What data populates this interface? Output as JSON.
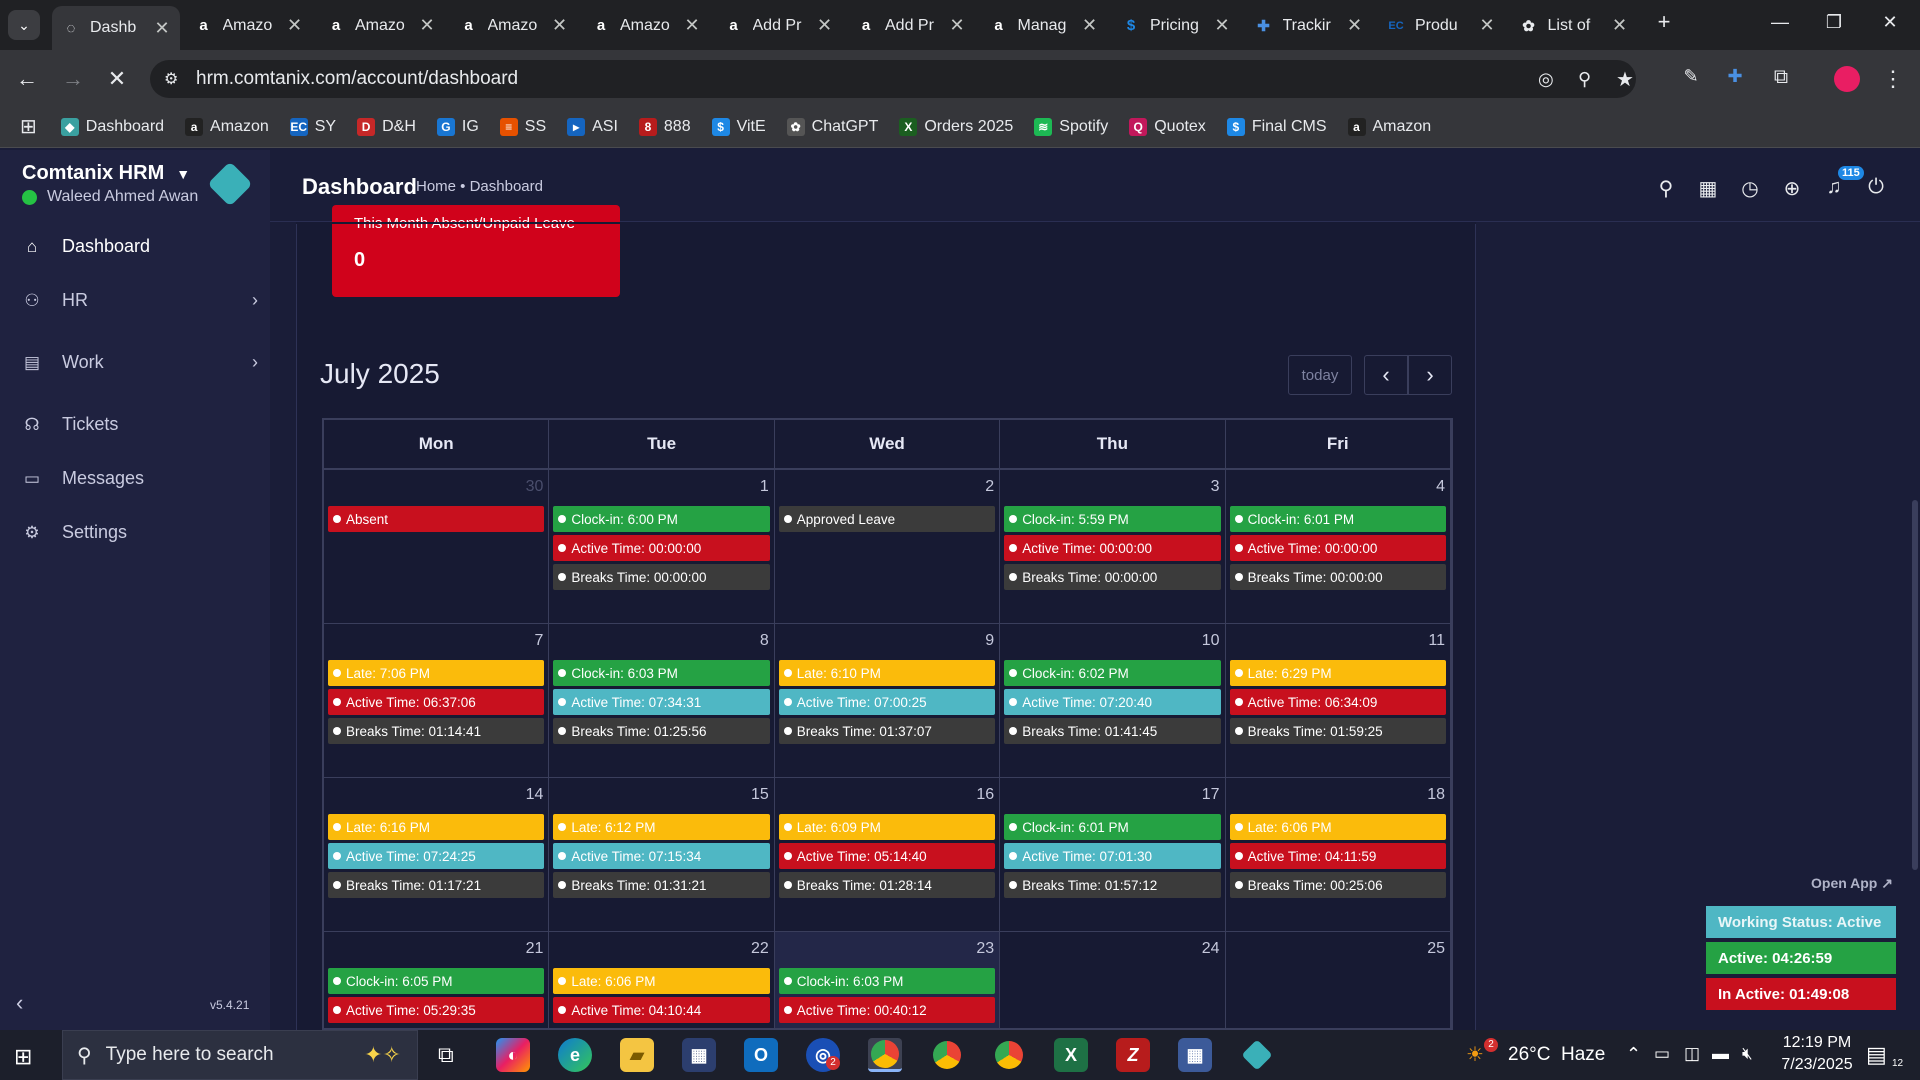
{
  "browser": {
    "tabs": [
      {
        "title": "Dashb",
        "icon": "loading-icon",
        "active": true
      },
      {
        "title": "Amazo",
        "icon": "amazon-icon"
      },
      {
        "title": "Amazo",
        "icon": "amazon-icon"
      },
      {
        "title": "Amazo",
        "icon": "amazon-icon"
      },
      {
        "title": "Amazo",
        "icon": "amazon-icon"
      },
      {
        "title": "Add Pr",
        "icon": "amazon-icon"
      },
      {
        "title": "Add Pr",
        "icon": "amazon-icon"
      },
      {
        "title": "Manag",
        "icon": "amazon-icon"
      },
      {
        "title": "Pricing",
        "icon": "dollar-icon"
      },
      {
        "title": "Trackir",
        "icon": "tracking-icon"
      },
      {
        "title": "Produ",
        "icon": "ec-icon"
      },
      {
        "title": "List of",
        "icon": "openai-icon"
      }
    ],
    "url": "hrm.comtanix.com/account/dashboard",
    "bookmarks": [
      {
        "label": "Dashboard",
        "color": "#3aa0a0",
        "glyph": "◆"
      },
      {
        "label": "Amazon",
        "color": "#222",
        "glyph": "a"
      },
      {
        "label": "SY",
        "color": "#1565c0",
        "glyph": "EC"
      },
      {
        "label": "D&H",
        "color": "#c62828",
        "glyph": "D"
      },
      {
        "label": "IG",
        "color": "#1976d2",
        "glyph": "G"
      },
      {
        "label": "SS",
        "color": "#e65100",
        "glyph": "≡"
      },
      {
        "label": "ASI",
        "color": "#1565c0",
        "glyph": "▸"
      },
      {
        "label": "888",
        "color": "#b71c1c",
        "glyph": "8"
      },
      {
        "label": "VitE",
        "color": "#1e88e5",
        "glyph": "$"
      },
      {
        "label": "ChatGPT",
        "color": "#555",
        "glyph": "✿"
      },
      {
        "label": "Orders 2025",
        "color": "#1b5e20",
        "glyph": "X"
      },
      {
        "label": "Spotify",
        "color": "#1db954",
        "glyph": "≋"
      },
      {
        "label": "Quotex",
        "color": "#c2185b",
        "glyph": "Q"
      },
      {
        "label": "Final CMS",
        "color": "#1e88e5",
        "glyph": "$"
      },
      {
        "label": "Amazon",
        "color": "#222",
        "glyph": "a"
      }
    ]
  },
  "app": {
    "brand": "Comtanix HRM",
    "user": "Waleed Ahmed Awan",
    "version": "v5.4.21",
    "page_title": "Dashboard",
    "breadcrumb": "Home • Dashboard",
    "notification_count": "115",
    "nav": [
      {
        "label": "Dashboard",
        "icon": "home-icon",
        "glyph": "⌂",
        "chevron": false
      },
      {
        "label": "HR",
        "icon": "users-icon",
        "glyph": "⚇",
        "chevron": true
      },
      {
        "label": "Work",
        "icon": "briefcase-icon",
        "glyph": "▤",
        "chevron": true
      },
      {
        "label": "Tickets",
        "icon": "headset-icon",
        "glyph": "☊",
        "chevron": false
      },
      {
        "label": "Messages",
        "icon": "message-icon",
        "glyph": "▭",
        "chevron": false
      },
      {
        "label": "Settings",
        "icon": "gear-icon",
        "glyph": "⚙",
        "chevron": false
      }
    ]
  },
  "absent_card": {
    "title": "This Month Absent/Unpaid Leave",
    "value": "0"
  },
  "calendar": {
    "title": "July 2025",
    "today_label": "today",
    "days": [
      "Mon",
      "Tue",
      "Wed",
      "Thu",
      "Fri"
    ],
    "weeks": [
      [
        {
          "d": "30",
          "muted": true,
          "ev": [
            [
              "Absent",
              "r"
            ]
          ]
        },
        {
          "d": "1",
          "ev": [
            [
              "Clock-in: 6:00 PM",
              "g"
            ],
            [
              "Active Time: 00:00:00",
              "r"
            ],
            [
              "Breaks Time: 00:00:00",
              "k"
            ]
          ]
        },
        {
          "d": "2",
          "ev": [
            [
              "Approved Leave",
              "k"
            ]
          ]
        },
        {
          "d": "3",
          "ev": [
            [
              "Clock-in: 5:59 PM",
              "g"
            ],
            [
              "Active Time: 00:00:00",
              "r"
            ],
            [
              "Breaks Time: 00:00:00",
              "k"
            ]
          ]
        },
        {
          "d": "4",
          "ev": [
            [
              "Clock-in: 6:01 PM",
              "g"
            ],
            [
              "Active Time: 00:00:00",
              "r"
            ],
            [
              "Breaks Time: 00:00:00",
              "k"
            ]
          ]
        }
      ],
      [
        {
          "d": "7",
          "ev": [
            [
              "Late: 7:06 PM",
              "y"
            ],
            [
              "Active Time: 06:37:06",
              "r"
            ],
            [
              "Breaks Time: 01:14:41",
              "k"
            ]
          ]
        },
        {
          "d": "8",
          "ev": [
            [
              "Clock-in: 6:03 PM",
              "g"
            ],
            [
              "Active Time: 07:34:31",
              "c"
            ],
            [
              "Breaks Time: 01:25:56",
              "k"
            ]
          ]
        },
        {
          "d": "9",
          "ev": [
            [
              "Late: 6:10 PM",
              "y"
            ],
            [
              "Active Time: 07:00:25",
              "c"
            ],
            [
              "Breaks Time: 01:37:07",
              "k"
            ]
          ]
        },
        {
          "d": "10",
          "ev": [
            [
              "Clock-in: 6:02 PM",
              "g"
            ],
            [
              "Active Time: 07:20:40",
              "c"
            ],
            [
              "Breaks Time: 01:41:45",
              "k"
            ]
          ]
        },
        {
          "d": "11",
          "ev": [
            [
              "Late: 6:29 PM",
              "y"
            ],
            [
              "Active Time: 06:34:09",
              "r"
            ],
            [
              "Breaks Time: 01:59:25",
              "k"
            ]
          ]
        }
      ],
      [
        {
          "d": "14",
          "ev": [
            [
              "Late: 6:16 PM",
              "y"
            ],
            [
              "Active Time: 07:24:25",
              "c"
            ],
            [
              "Breaks Time: 01:17:21",
              "k"
            ]
          ]
        },
        {
          "d": "15",
          "ev": [
            [
              "Late: 6:12 PM",
              "y"
            ],
            [
              "Active Time: 07:15:34",
              "c"
            ],
            [
              "Breaks Time: 01:31:21",
              "k"
            ]
          ]
        },
        {
          "d": "16",
          "ev": [
            [
              "Late: 6:09 PM",
              "y"
            ],
            [
              "Active Time: 05:14:40",
              "r"
            ],
            [
              "Breaks Time: 01:28:14",
              "k"
            ]
          ]
        },
        {
          "d": "17",
          "ev": [
            [
              "Clock-in: 6:01 PM",
              "g"
            ],
            [
              "Active Time: 07:01:30",
              "c"
            ],
            [
              "Breaks Time: 01:57:12",
              "k"
            ]
          ]
        },
        {
          "d": "18",
          "ev": [
            [
              "Late: 6:06 PM",
              "y"
            ],
            [
              "Active Time: 04:11:59",
              "r"
            ],
            [
              "Breaks Time: 00:25:06",
              "k"
            ]
          ]
        }
      ],
      [
        {
          "d": "21",
          "ev": [
            [
              "Clock-in: 6:05 PM",
              "g"
            ],
            [
              "Active Time: 05:29:35",
              "r"
            ]
          ]
        },
        {
          "d": "22",
          "ev": [
            [
              "Late: 6:06 PM",
              "y"
            ],
            [
              "Active Time: 04:10:44",
              "r"
            ]
          ]
        },
        {
          "d": "23",
          "today": true,
          "ev": [
            [
              "Clock-in: 6:03 PM",
              "g"
            ],
            [
              "Active Time: 00:40:12",
              "r"
            ]
          ]
        },
        {
          "d": "24",
          "ev": []
        },
        {
          "d": "25",
          "ev": []
        }
      ]
    ],
    "colors": {
      "g": "#25a244",
      "r": "#c8101e",
      "k": "#3b3b3b",
      "y": "#fbbb0b",
      "c": "#4fb7c4"
    }
  },
  "widget": {
    "open_app": "Open App ↗",
    "status": "Working Status: Active",
    "active": "Active: 04:26:59",
    "inactive": "In Active: 01:49:08"
  },
  "taskbar": {
    "search_placeholder": "Type here to search",
    "weather": "26°C  Haze",
    "weather_badge": "2",
    "time": "12:19 PM",
    "date": "7/23/2025",
    "notif_count": "12",
    "outlook_badge": "2"
  }
}
